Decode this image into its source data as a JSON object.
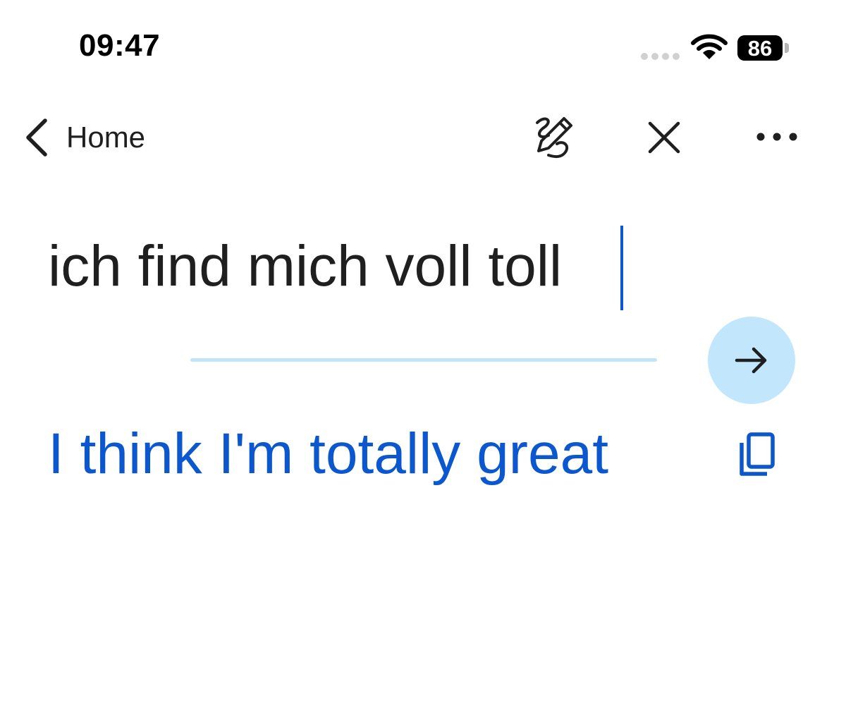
{
  "status_bar": {
    "time": "09:47",
    "battery_level": "86",
    "icons": [
      "signal-dots-icon",
      "wifi-icon",
      "battery-icon"
    ]
  },
  "nav": {
    "back_label": "Home",
    "icons": [
      "chevron-left-icon",
      "handwriting-icon",
      "close-icon",
      "more-horizontal-icon"
    ]
  },
  "input": {
    "source_text": "ich find mich voll toll"
  },
  "translate_button": {
    "icon": "arrow-right-icon"
  },
  "output": {
    "translation_text": "I think I'm totally great",
    "copy_icon": "copy-icon"
  },
  "colors": {
    "accent": "#0b57d0",
    "translate_button_bg": "#c2e7fd",
    "divider": "#c2e4f8",
    "text": "#1f1f1f"
  }
}
